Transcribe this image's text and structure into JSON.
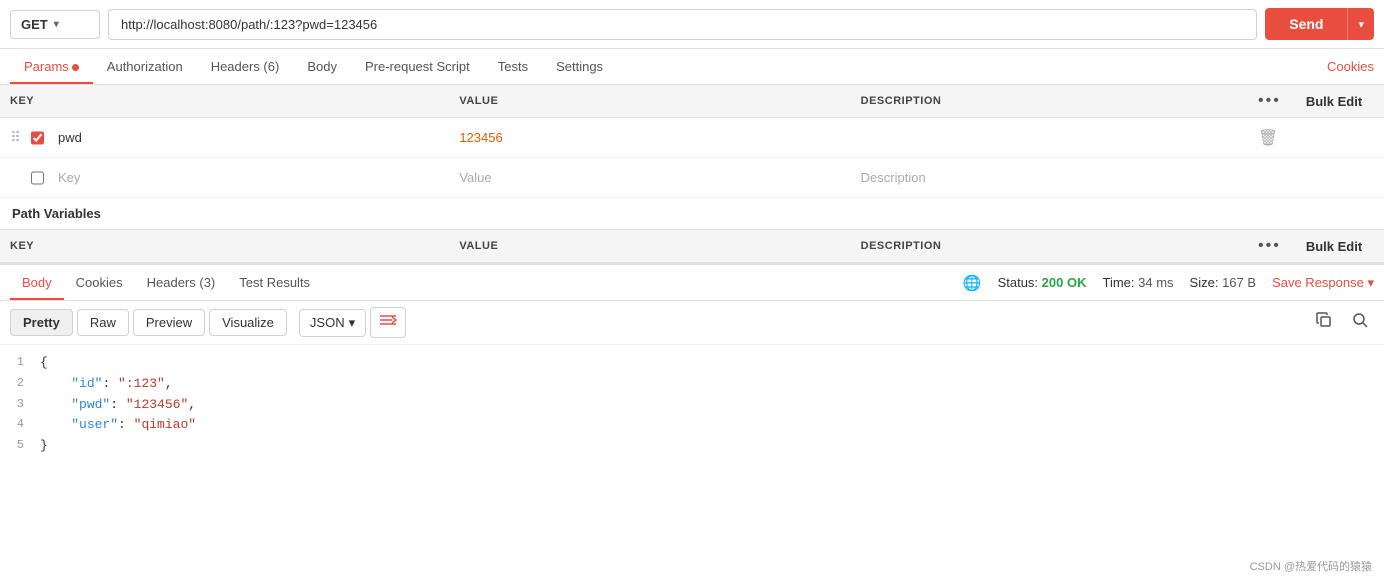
{
  "topbar": {
    "method": "GET",
    "chevron": "▾",
    "url": "http://localhost:8080/path/:123?pwd=123456",
    "send_label": "Send",
    "send_arrow": "▾"
  },
  "request_tabs": [
    {
      "id": "params",
      "label": "Params",
      "has_dot": true,
      "active": true
    },
    {
      "id": "authorization",
      "label": "Authorization",
      "has_dot": false
    },
    {
      "id": "headers",
      "label": "Headers (6)",
      "has_dot": false
    },
    {
      "id": "body",
      "label": "Body",
      "has_dot": false
    },
    {
      "id": "pre-request",
      "label": "Pre-request Script",
      "has_dot": false
    },
    {
      "id": "tests",
      "label": "Tests",
      "has_dot": false
    },
    {
      "id": "settings",
      "label": "Settings",
      "has_dot": false
    }
  ],
  "cookies_link": "Cookies",
  "query_params": {
    "table_header": {
      "key_col": "KEY",
      "value_col": "VALUE",
      "desc_col": "DESCRIPTION",
      "bulk_edit": "Bulk Edit"
    },
    "rows": [
      {
        "key": "pwd",
        "value": "123456",
        "description": "",
        "checked": true
      }
    ],
    "placeholder_row": {
      "key": "Key",
      "value": "Value",
      "description": "Description"
    }
  },
  "path_variables": {
    "section_label": "Path Variables",
    "table_header": {
      "key_col": "KEY",
      "value_col": "VALUE",
      "desc_col": "DESCRIPTION",
      "bulk_edit": "Bulk Edit"
    }
  },
  "response_tabs": [
    {
      "id": "body",
      "label": "Body",
      "active": true
    },
    {
      "id": "cookies",
      "label": "Cookies"
    },
    {
      "id": "headers",
      "label": "Headers (3)"
    },
    {
      "id": "test-results",
      "label": "Test Results"
    }
  ],
  "response_meta": {
    "status_label": "Status:",
    "status_value": "200 OK",
    "time_label": "Time:",
    "time_value": "34 ms",
    "size_label": "Size:",
    "size_value": "167 B",
    "save_response": "Save Response",
    "chevron": "▾"
  },
  "format_toolbar": {
    "pretty": "Pretty",
    "raw": "Raw",
    "preview": "Preview",
    "visualize": "Visualize",
    "format": "JSON",
    "chevron": "▾",
    "wrap_icon": "⇄"
  },
  "code_lines": [
    {
      "num": "1",
      "content": "{",
      "type": "brace"
    },
    {
      "num": "2",
      "content": "    \"id\": \":123\",",
      "key": "id",
      "val": ":123"
    },
    {
      "num": "3",
      "content": "    \"pwd\": \"123456\",",
      "key": "pwd",
      "val": "123456"
    },
    {
      "num": "4",
      "content": "    \"user\": \"qimiao\"",
      "key": "user",
      "val": "qimiao"
    },
    {
      "num": "5",
      "content": "}",
      "type": "brace"
    }
  ],
  "footer": {
    "text": "CSDN @热爱代码的猿猿"
  }
}
